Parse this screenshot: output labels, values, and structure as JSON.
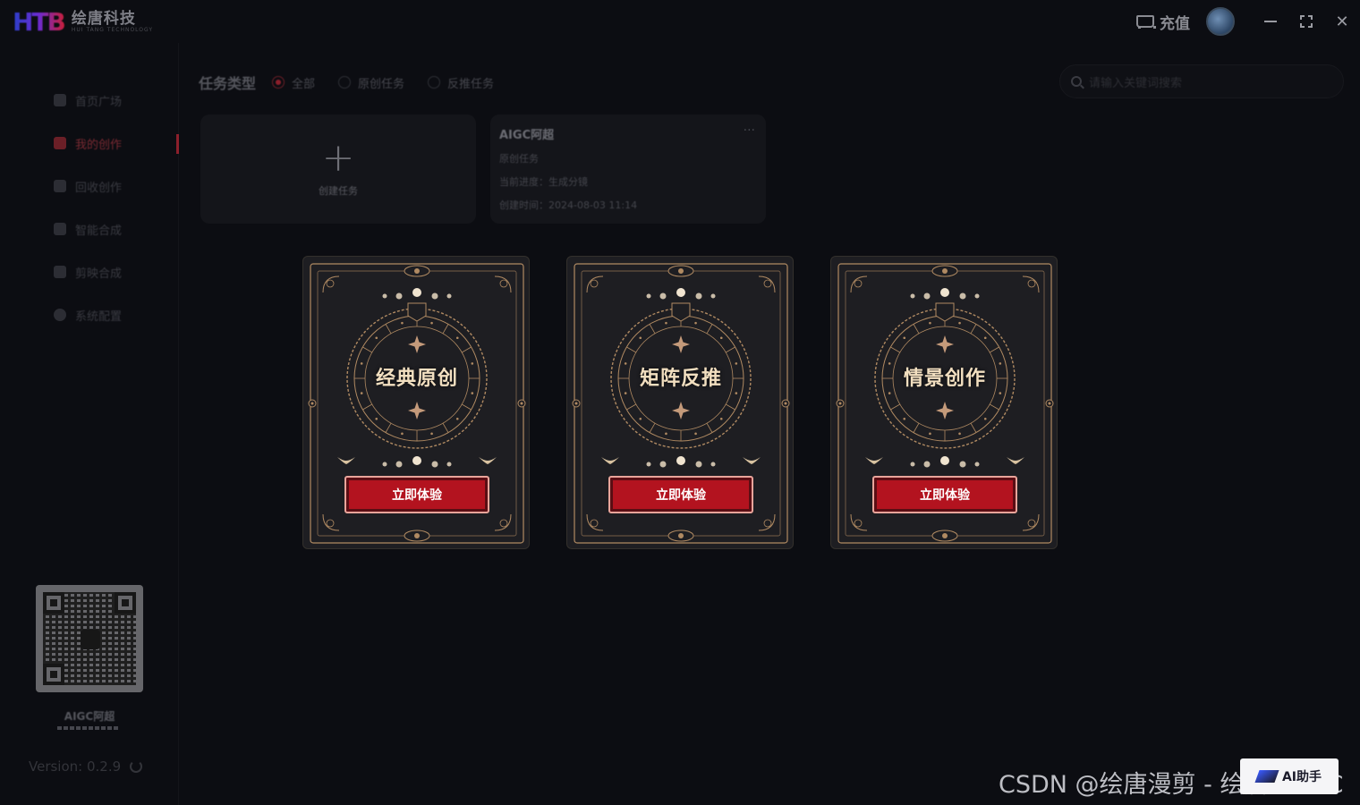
{
  "app": {
    "logo_mark": "HTB",
    "logo_name": "绘唐科技",
    "logo_sub": "HUI TANG TECHNOLOGY",
    "recharge_label": "充值"
  },
  "sidebar": {
    "items": [
      {
        "label": "首页广场",
        "active": false
      },
      {
        "label": "我的创作",
        "active": true
      },
      {
        "label": "回收创作",
        "active": false
      },
      {
        "label": "智能合成",
        "active": false
      },
      {
        "label": "剪映合成",
        "active": false
      },
      {
        "label": "系统配置",
        "active": false
      }
    ],
    "qr_caption": "AIGC阿超",
    "version": "Version: 0.2.9"
  },
  "filter": {
    "title": "任务类型",
    "options": [
      {
        "label": "全部",
        "selected": true
      },
      {
        "label": "原创任务",
        "selected": false
      },
      {
        "label": "反推任务",
        "selected": false
      }
    ]
  },
  "search": {
    "placeholder": "请输入关键词搜索"
  },
  "create_card": {
    "label": "创建任务"
  },
  "task_card": {
    "name": "AIGC阿超",
    "type": "原创任务",
    "status": "当前进度：生成分镜",
    "created": "创建时间：2024-08-03 11:14"
  },
  "modes": [
    {
      "title": "经典原创",
      "button": "立即体验"
    },
    {
      "title": "矩阵反推",
      "button": "立即体验"
    },
    {
      "title": "情景创作",
      "button": "立即体验"
    }
  ],
  "watermark": "CSDN @绘唐漫剪 - 绘唐SAIGC",
  "badge": "AI助手",
  "colors": {
    "accent": "#b3131f",
    "card_gold": "#b08a62",
    "title_cream": "#f2dfc0"
  }
}
